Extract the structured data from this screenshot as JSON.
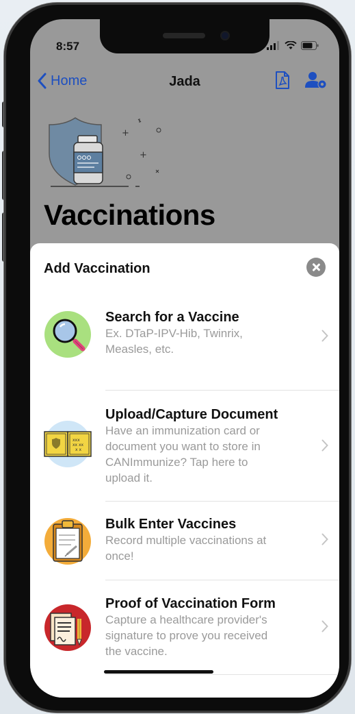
{
  "status_bar": {
    "time": "8:57"
  },
  "nav": {
    "back_label": "Home",
    "title": "Jada",
    "icons": [
      "pdf-icon",
      "user-settings-icon"
    ]
  },
  "page": {
    "title": "Vaccinations"
  },
  "sheet": {
    "title": "Add Vaccination",
    "options": [
      {
        "title": "Search for a Vaccine",
        "desc_lines": [
          "Ex. DTaP-IPV-Hib, Twinrix,",
          "Measles, etc."
        ],
        "icon": "magnifier-icon"
      },
      {
        "title": "Upload/Capture Document",
        "desc_lines": [
          "Have an immunization card or",
          "document you want to store in",
          "CANImmunize? Tap here to",
          "upload it."
        ],
        "icon": "immunization-card-icon"
      },
      {
        "title": "Bulk Enter Vaccines",
        "desc_lines": [
          "Record multiple vaccinations at",
          "once!"
        ],
        "icon": "clipboard-icon"
      },
      {
        "title": "Proof of Vaccination Form",
        "desc_lines": [
          "Capture a healthcare provider's",
          "signature to prove you received",
          "the vaccine."
        ],
        "icon": "signed-form-icon"
      }
    ]
  },
  "colors": {
    "accent": "#1d4fc0",
    "dim_background": "#999999",
    "sheet": "#ffffff"
  }
}
